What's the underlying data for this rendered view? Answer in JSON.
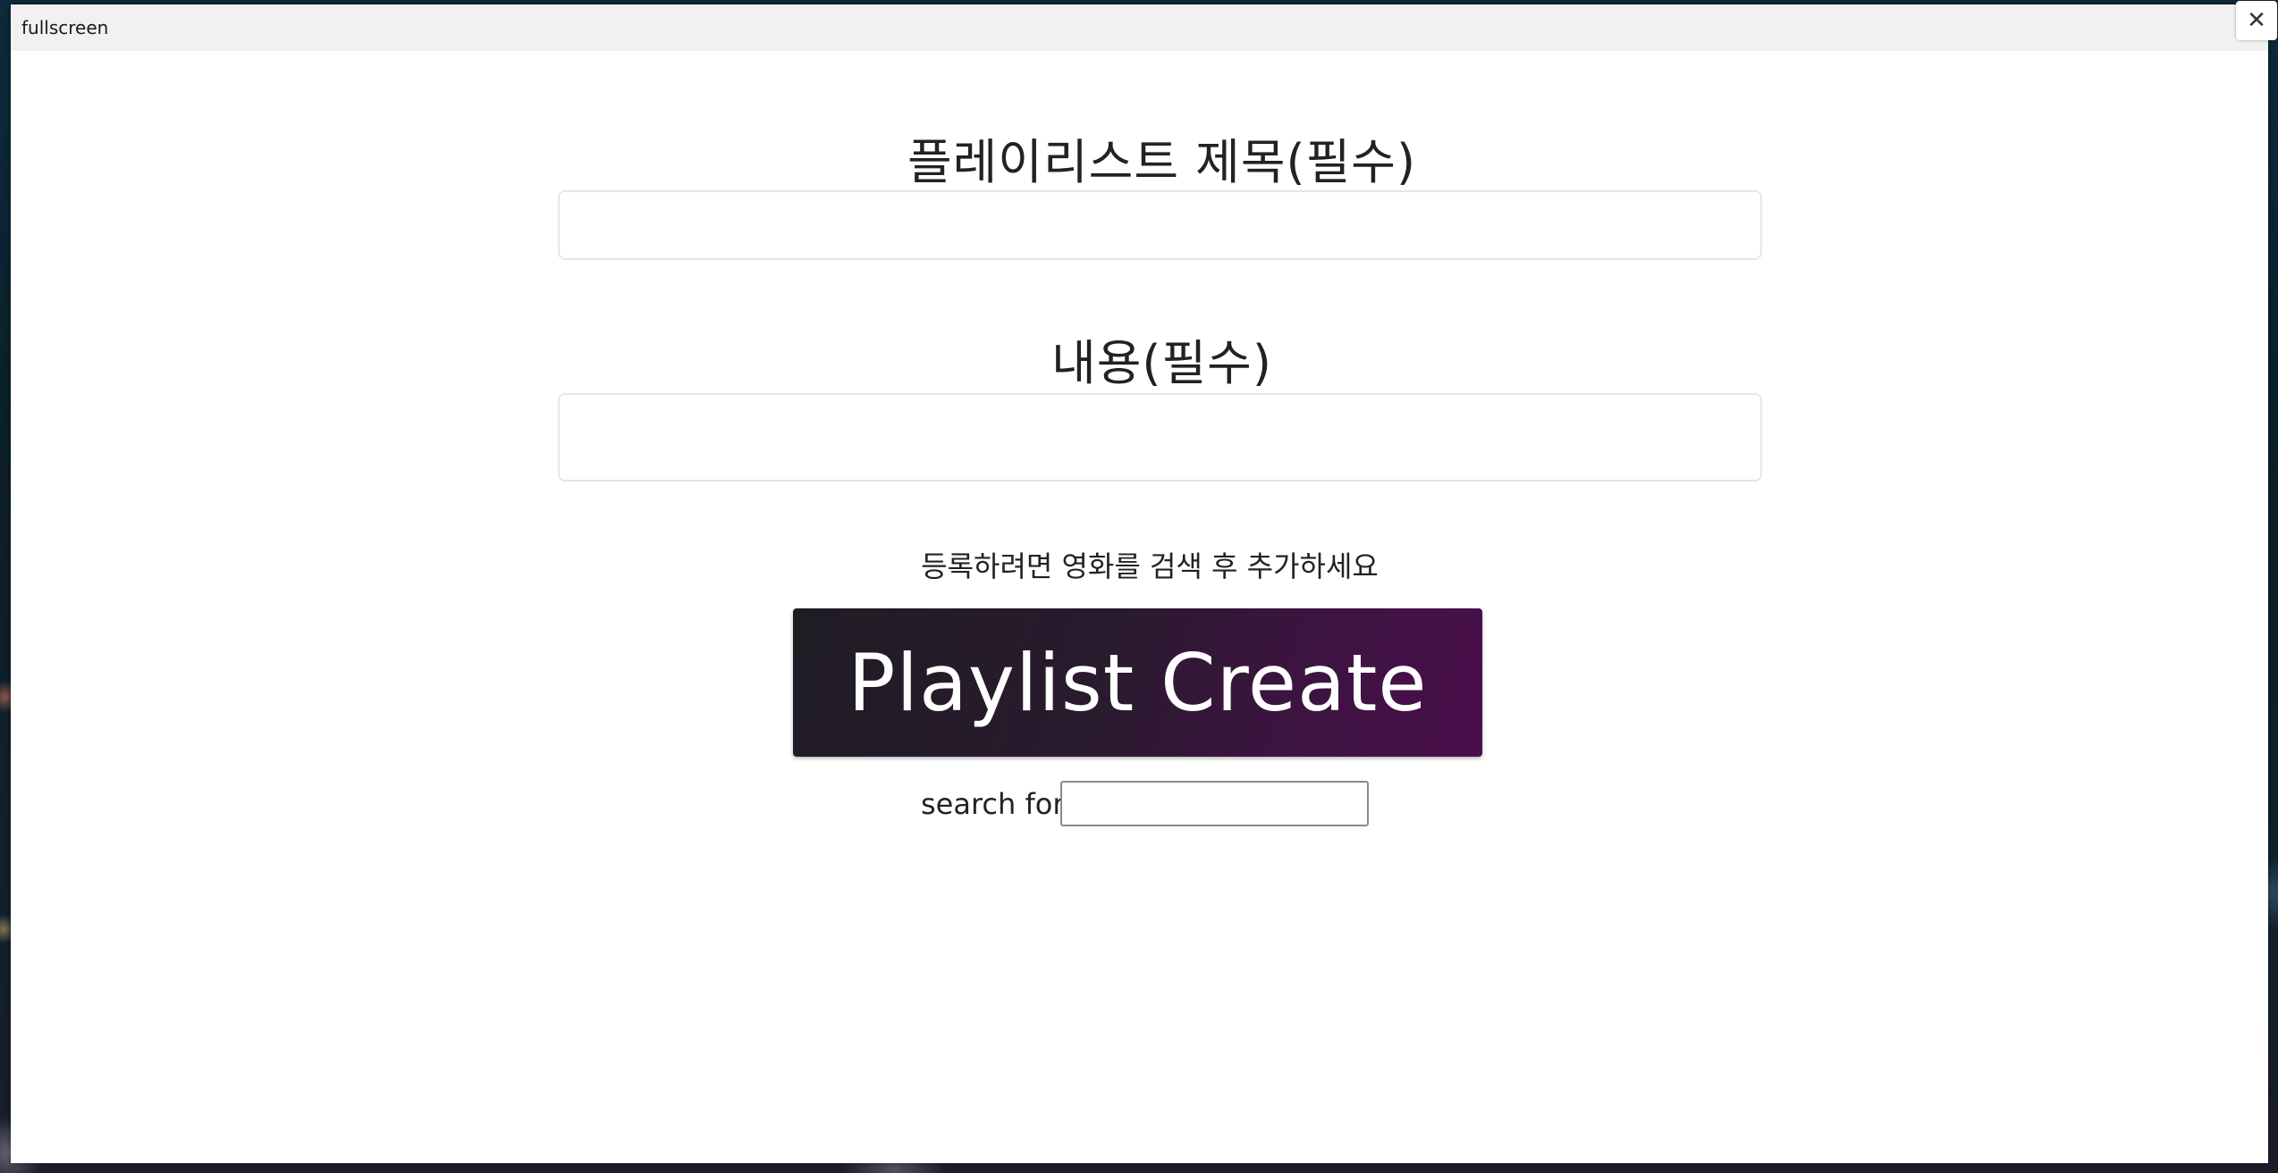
{
  "window": {
    "title": "fullscreen",
    "close_icon": "close-icon",
    "close_glyph": "✕"
  },
  "form": {
    "title_label": "플레이리스트 제목(필수)",
    "title_value": "",
    "content_label": "내용(필수)",
    "content_value": "",
    "hint": "등록하려면 영화를 검색 후 추가하세요",
    "create_button_label": "Playlist Create",
    "search_label": "search for",
    "search_value": ""
  },
  "colors": {
    "button_gradient_start": "#1f1c24",
    "button_gradient_end": "#4a0e4c",
    "button_text": "#ffffff"
  }
}
